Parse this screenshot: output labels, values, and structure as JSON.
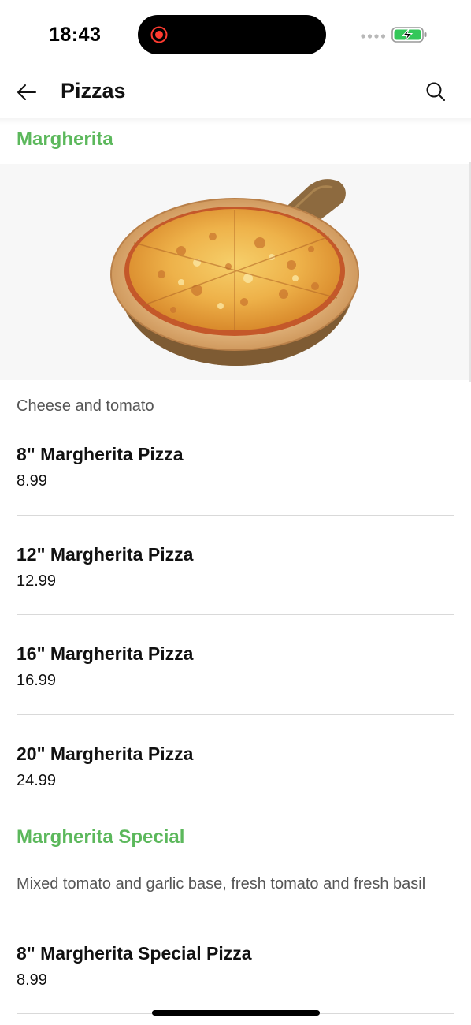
{
  "status_bar": {
    "time": "18:43"
  },
  "header": {
    "title": "Pizzas",
    "back_icon": "arrow-left-icon",
    "search_icon": "search-icon"
  },
  "colors": {
    "accent": "#5cb85c",
    "text": "#111111",
    "muted": "#555555",
    "divider": "#d9d9d9",
    "battery": "#34c759",
    "record": "#ff3b30"
  },
  "sections": [
    {
      "title": "Margherita",
      "image": "margherita-pizza-photo",
      "description": "Cheese and tomato",
      "items": [
        {
          "name": "8\" Margherita Pizza",
          "price": "8.99"
        },
        {
          "name": "12\" Margherita Pizza",
          "price": "12.99"
        },
        {
          "name": "16\" Margherita Pizza",
          "price": "16.99"
        },
        {
          "name": "20\" Margherita Pizza",
          "price": "24.99"
        }
      ]
    },
    {
      "title": "Margherita Special",
      "description": "Mixed tomato and garlic base, fresh tomato and fresh basil",
      "items": [
        {
          "name": "8\" Margherita Special Pizza",
          "price": "8.99"
        }
      ]
    }
  ]
}
